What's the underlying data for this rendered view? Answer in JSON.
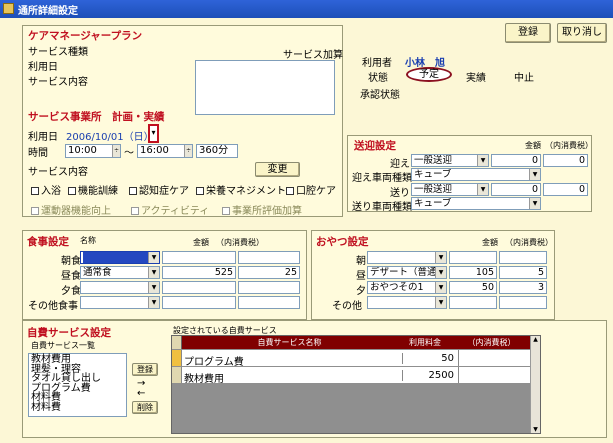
{
  "window": {
    "title": "通所詳細設定"
  },
  "buttons": {
    "register": "登録",
    "cancel": "取り消し",
    "change": "変更",
    "add": "登録",
    "delete": "削除"
  },
  "care": {
    "header": "ケアマネージャープラン",
    "service_type": "サービス種類",
    "use_date": "利用日",
    "service_content": "サービス内容",
    "service_add_label": "サービス加算"
  },
  "user": {
    "label": "利用者",
    "name": "小林　旭",
    "status_label": "状態",
    "status_options": [
      "予定",
      "実績",
      "中止"
    ],
    "approval_label": "承認状態"
  },
  "provider": {
    "header": "サービス事業所　計画・実績",
    "use_date_label": "利用日",
    "use_date": "2006/10/01（日）",
    "time_label": "時間",
    "start": "10:00",
    "tilde": "～",
    "end": "16:00",
    "duration": "360分",
    "service_content_label": "サービス内容",
    "checks": [
      "入浴",
      "機能訓練",
      "認知症ケア",
      "栄養マネジメント",
      "口腔ケア"
    ],
    "checks2": [
      "運動器機能向上",
      "アクティビティ",
      "事業所評価加算"
    ]
  },
  "transport": {
    "header": "送迎設定",
    "amount_col": "金額",
    "tax_col": "（内消費税）",
    "rows": [
      {
        "label": "迎え",
        "value": "一般送迎",
        "amount": "0",
        "tax": "0"
      },
      {
        "label": "迎え車両種類",
        "value": "キューブ"
      },
      {
        "label": "送り",
        "value": "一般送迎",
        "amount": "0",
        "tax": "0"
      },
      {
        "label": "送り車両種類",
        "value": "キューブ"
      }
    ]
  },
  "meal": {
    "header": "食事設定",
    "name_col": "名称",
    "amount_col": "金額",
    "tax_col": "（内消費税）",
    "rows": [
      {
        "label": "朝食",
        "value": "",
        "amount": "",
        "tax": ""
      },
      {
        "label": "昼食",
        "value": "通常食",
        "amount": "525",
        "tax": "25"
      },
      {
        "label": "夕食",
        "value": "",
        "amount": "",
        "tax": ""
      },
      {
        "label": "その他食事",
        "value": "",
        "amount": "",
        "tax": ""
      }
    ]
  },
  "snack": {
    "header": "おやつ設定",
    "name_col": "名称",
    "amount_col": "金額",
    "tax_col": "（内消費税）",
    "rows": [
      {
        "label": "朝",
        "value": "",
        "amount": "",
        "tax": ""
      },
      {
        "label": "昼",
        "value": "デザート（普通）",
        "amount": "105",
        "tax": "5"
      },
      {
        "label": "夕",
        "value": "おやつその1",
        "amount": "50",
        "tax": "3"
      },
      {
        "label": "その他",
        "value": "",
        "amount": "",
        "tax": ""
      }
    ]
  },
  "selfpay": {
    "header": "自費サービス設定",
    "list_label": "自費サービス一覧",
    "set_label": "設定されている自費サービス",
    "list": [
      "教材費用",
      "理髪・理容",
      "タオル貸し出し",
      "プログラム費",
      "材料費",
      "材料費"
    ],
    "arrow_right": "→",
    "arrow_left": "←",
    "cols": [
      "自費サービス名称",
      "利用料金",
      "（内消費税）"
    ],
    "rows": [
      {
        "name": "プログラム費",
        "fee": "50",
        "tax": ""
      },
      {
        "name": "教材費用",
        "fee": "2500",
        "tax": ""
      }
    ]
  },
  "colors": {
    "accent_red": "#c01020",
    "date_blue": "#1a3fb0",
    "title_blue": "#1d4fb8",
    "panel_bg": "#fffbdc",
    "grid_header": "#800000"
  }
}
